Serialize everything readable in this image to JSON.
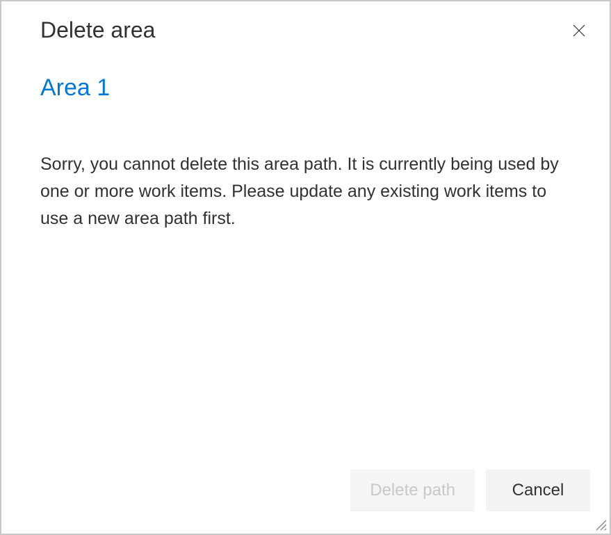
{
  "dialog": {
    "title": "Delete area",
    "area_name": "Area 1",
    "message": "Sorry, you cannot delete this area path. It is currently being used by one or more work items. Please update any existing work items to use a new area path first.",
    "buttons": {
      "delete_label": "Delete path",
      "cancel_label": "Cancel"
    }
  }
}
